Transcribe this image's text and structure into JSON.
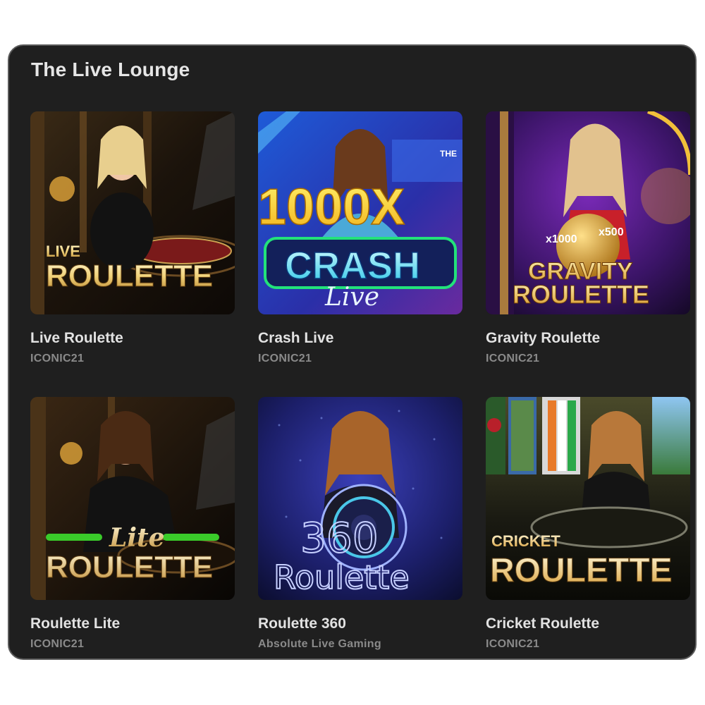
{
  "section": {
    "title": "The Live Lounge"
  },
  "games": [
    {
      "name": "Live Roulette",
      "provider": "ICONIC21",
      "logo_small": "LIVE",
      "logo_big": "ROULETTE"
    },
    {
      "name": "Crash Live",
      "provider": "ICONIC21",
      "logo_multiplier": "1000X",
      "logo_big": "CRASH",
      "logo_script": "Live"
    },
    {
      "name": "Gravity Roulette",
      "provider": "ICONIC21",
      "logo_small_left": "x1000",
      "logo_small_right": "x500",
      "logo_line1": "GRAVITY",
      "logo_line2": "ROULETTE"
    },
    {
      "name": "Roulette Lite",
      "provider": "ICONIC21",
      "logo_script": "Lite",
      "logo_big": "ROULETTE"
    },
    {
      "name": "Roulette 360",
      "provider": "Absolute Live Gaming",
      "logo_number": "360",
      "logo_script": "Roulette"
    },
    {
      "name": "Cricket Roulette",
      "provider": "ICONIC21",
      "logo_small": "CRICKET",
      "logo_big": "ROULETTE"
    }
  ],
  "colors": {
    "panel_bg": "#1f1f1f",
    "title": "#e6e6e6",
    "name": "#e2e2e2",
    "provider": "#8a8a8a"
  }
}
